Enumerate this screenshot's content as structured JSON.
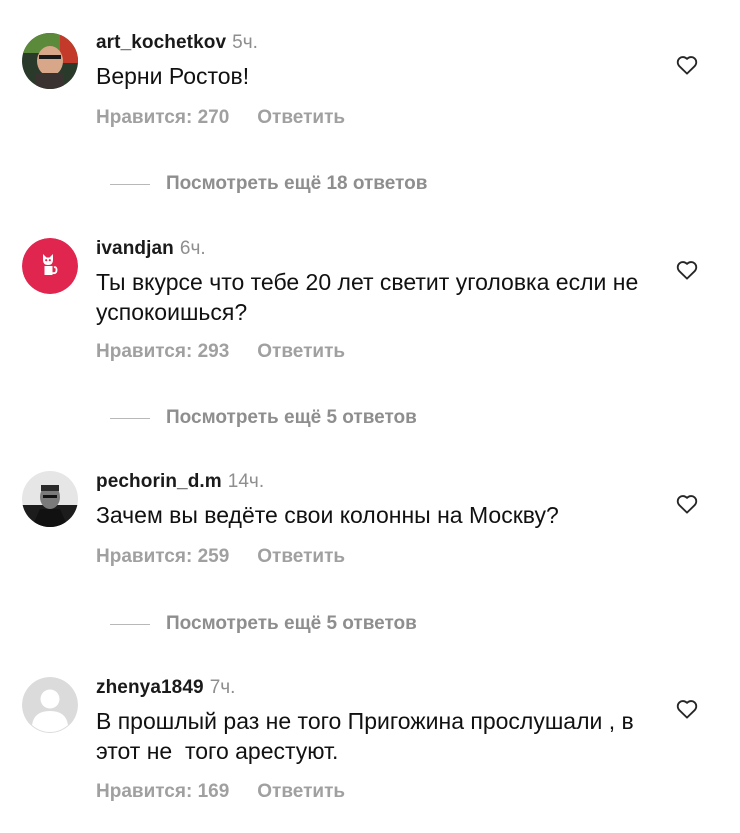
{
  "comments": [
    {
      "username": "art_kochetkov",
      "time": "5ч.",
      "text": "Верни Ростов!",
      "likes": "Нравится: 270",
      "reply": "Ответить",
      "avatar": "user-photo",
      "view_replies": "Посмотреть ещё 18 ответов"
    },
    {
      "username": "ivandjan",
      "time": "6ч.",
      "text": "Ты вкурсе что тебе 20 лет светит уголовка если не успокоишься?",
      "likes": "Нравится: 293",
      "reply": "Ответить",
      "avatar": "cat-logo",
      "avatar_color": "#e0264f",
      "view_replies": "Посмотреть ещё 5 ответов"
    },
    {
      "username": "pechorin_d.m",
      "time": "14ч.",
      "text": "Зачем вы ведёте свои колонны на Москву?",
      "likes": "Нравится: 259",
      "reply": "Ответить",
      "avatar": "bw-photo",
      "view_replies": "Посмотреть ещё 5 ответов"
    },
    {
      "username": "zhenya1849",
      "time": "7ч.",
      "text": "В прошлый раз не того Пригожина прослушали , в этот не  того арестуют.",
      "likes": "Нравится: 169",
      "reply": "Ответить",
      "avatar": "default-avatar"
    }
  ],
  "icons": {
    "like": "heart-outline-icon"
  }
}
